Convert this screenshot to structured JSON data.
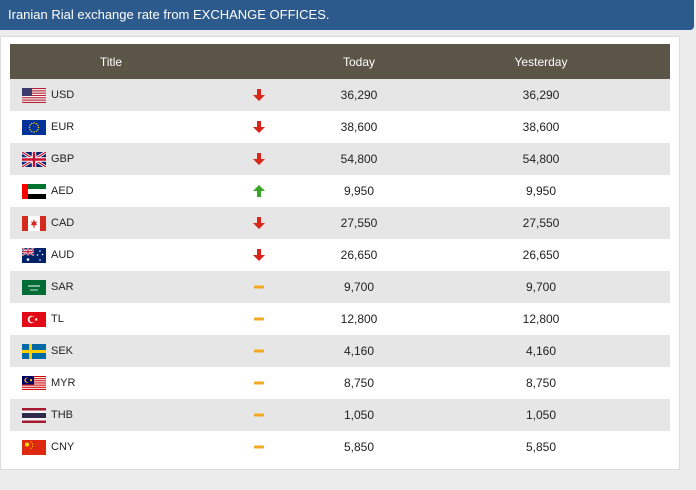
{
  "header": {
    "title": "Iranian Rial exchange rate from EXCHANGE OFFICES."
  },
  "table": {
    "columns": [
      "Title",
      "",
      "Today",
      "Yesterday"
    ],
    "rows": [
      {
        "code": "USD",
        "trend": "down",
        "today": "36,290",
        "yesterday": "36,290",
        "flag": "us"
      },
      {
        "code": "EUR",
        "trend": "down",
        "today": "38,600",
        "yesterday": "38,600",
        "flag": "eu"
      },
      {
        "code": "GBP",
        "trend": "down",
        "today": "54,800",
        "yesterday": "54,800",
        "flag": "gb"
      },
      {
        "code": "AED",
        "trend": "up",
        "today": "9,950",
        "yesterday": "9,950",
        "flag": "ae"
      },
      {
        "code": "CAD",
        "trend": "down",
        "today": "27,550",
        "yesterday": "27,550",
        "flag": "ca"
      },
      {
        "code": "AUD",
        "trend": "down",
        "today": "26,650",
        "yesterday": "26,650",
        "flag": "au"
      },
      {
        "code": "SAR",
        "trend": "same",
        "today": "9,700",
        "yesterday": "9,700",
        "flag": "sa"
      },
      {
        "code": "TL",
        "trend": "same",
        "today": "12,800",
        "yesterday": "12,800",
        "flag": "tr"
      },
      {
        "code": "SEK",
        "trend": "same",
        "today": "4,160",
        "yesterday": "4,160",
        "flag": "se"
      },
      {
        "code": "MYR",
        "trend": "same",
        "today": "8,750",
        "yesterday": "8,750",
        "flag": "my"
      },
      {
        "code": "THB",
        "trend": "same",
        "today": "1,050",
        "yesterday": "1,050",
        "flag": "th"
      },
      {
        "code": "CNY",
        "trend": "same",
        "today": "5,850",
        "yesterday": "5,850",
        "flag": "cn"
      }
    ]
  },
  "colors": {
    "header_bg": "#2d5a8c",
    "table_header_bg": "#5b5548",
    "down": "#d9261c",
    "up": "#3aa527",
    "same": "#f5a623"
  }
}
